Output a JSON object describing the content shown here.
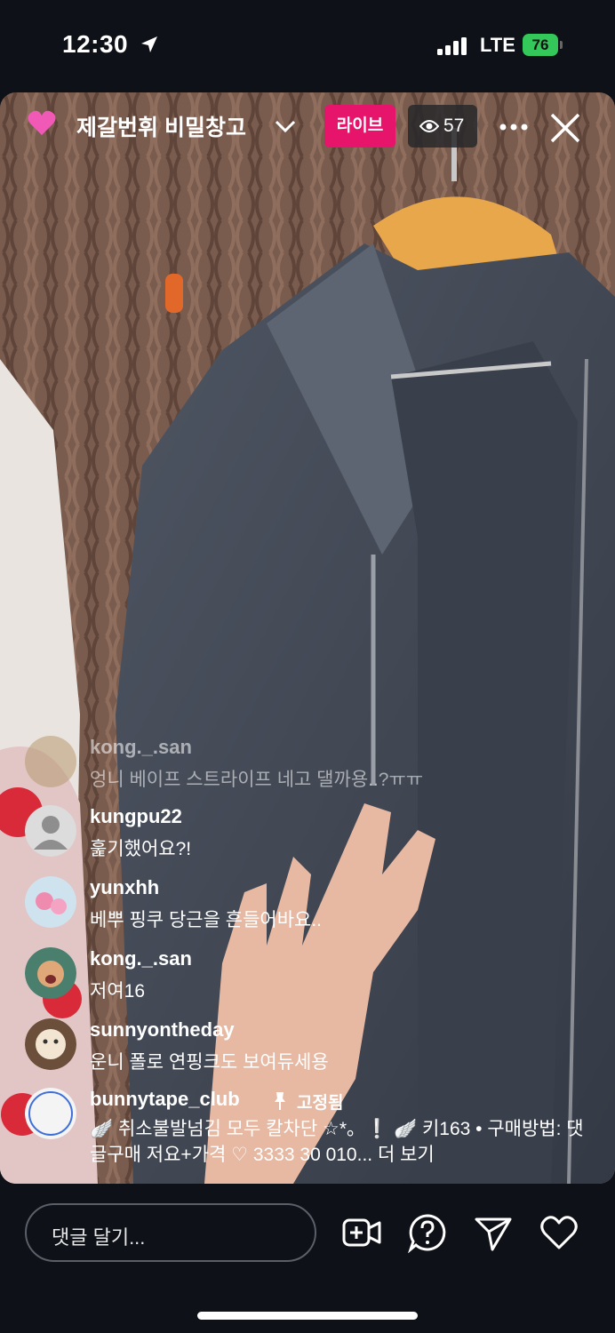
{
  "status_bar": {
    "time": "12:30",
    "network": "LTE",
    "battery": "76"
  },
  "header": {
    "channel_title": "제갈번휘 비밀창고",
    "live_label": "라이브",
    "viewer_count": "57"
  },
  "comments": [
    {
      "username": "kong._.san",
      "message": "엉니 베이프 스트라이프 네고 댈까용..?ㅠㅠ"
    },
    {
      "username": "kungpu22",
      "message": "훑기했어요?!"
    },
    {
      "username": "yunxhh",
      "message": "베뿌 핑쿠 당근을 흔들어바요.."
    },
    {
      "username": "kong._.san",
      "message": "저여16"
    },
    {
      "username": "sunnyontheday",
      "message": "운니 폴로 연핑크도 보여듀세용"
    }
  ],
  "pinned_comment": {
    "username": "bunnytape_club",
    "pinned_label": "고정됨",
    "avatar_text": "BUNNY TAPE CLUB",
    "text": "🪽 취소불발넘김 모두 칼차단 ☆*。❕ 🪽 키163 • 구매방법: 댓글구매 저요+가격 ♡ 3333 30 010... 더 보기"
  },
  "bottom_bar": {
    "comment_placeholder": "댓글 달기..."
  },
  "colors": {
    "live_badge": "#e6146b",
    "battery": "#34c759",
    "background": "#0e1117"
  }
}
